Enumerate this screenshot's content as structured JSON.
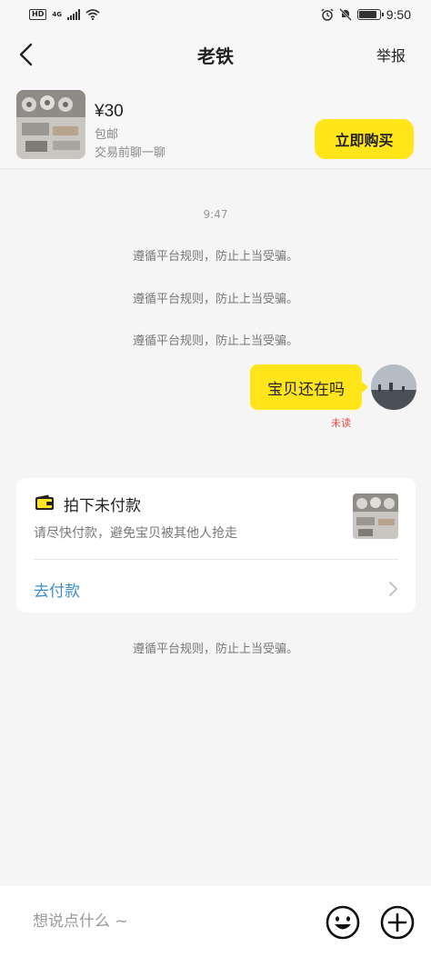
{
  "status_bar": {
    "hd": "HD",
    "network": "4G",
    "time": "9:50",
    "battery_level": 0.9
  },
  "nav": {
    "title": "老铁",
    "report_label": "举报",
    "back_icon": "chevron-left-icon"
  },
  "product": {
    "price": "¥30",
    "shipping": "包邮",
    "hint": "交易前聊一聊",
    "buy_label": "立即购买"
  },
  "chat": {
    "timestamp": "9:47",
    "system_notice": "遵循平台规则，防止上当受骗。",
    "messages": [
      {
        "text": "宝贝还在吗",
        "status": "未读"
      }
    ]
  },
  "order_card": {
    "title": "拍下未付款",
    "subtitle": "请尽快付款，避免宝贝被其他人抢走",
    "pay_label": "去付款",
    "icon": "wallet-icon"
  },
  "composer": {
    "placeholder": "想说点什么 ~",
    "emoji_icon": "emoji-icon",
    "plus_icon": "plus-icon"
  },
  "colors": {
    "accent_yellow": "#ffe51a",
    "link_blue": "#3c8dc9",
    "unread_red": "#e54d42"
  }
}
